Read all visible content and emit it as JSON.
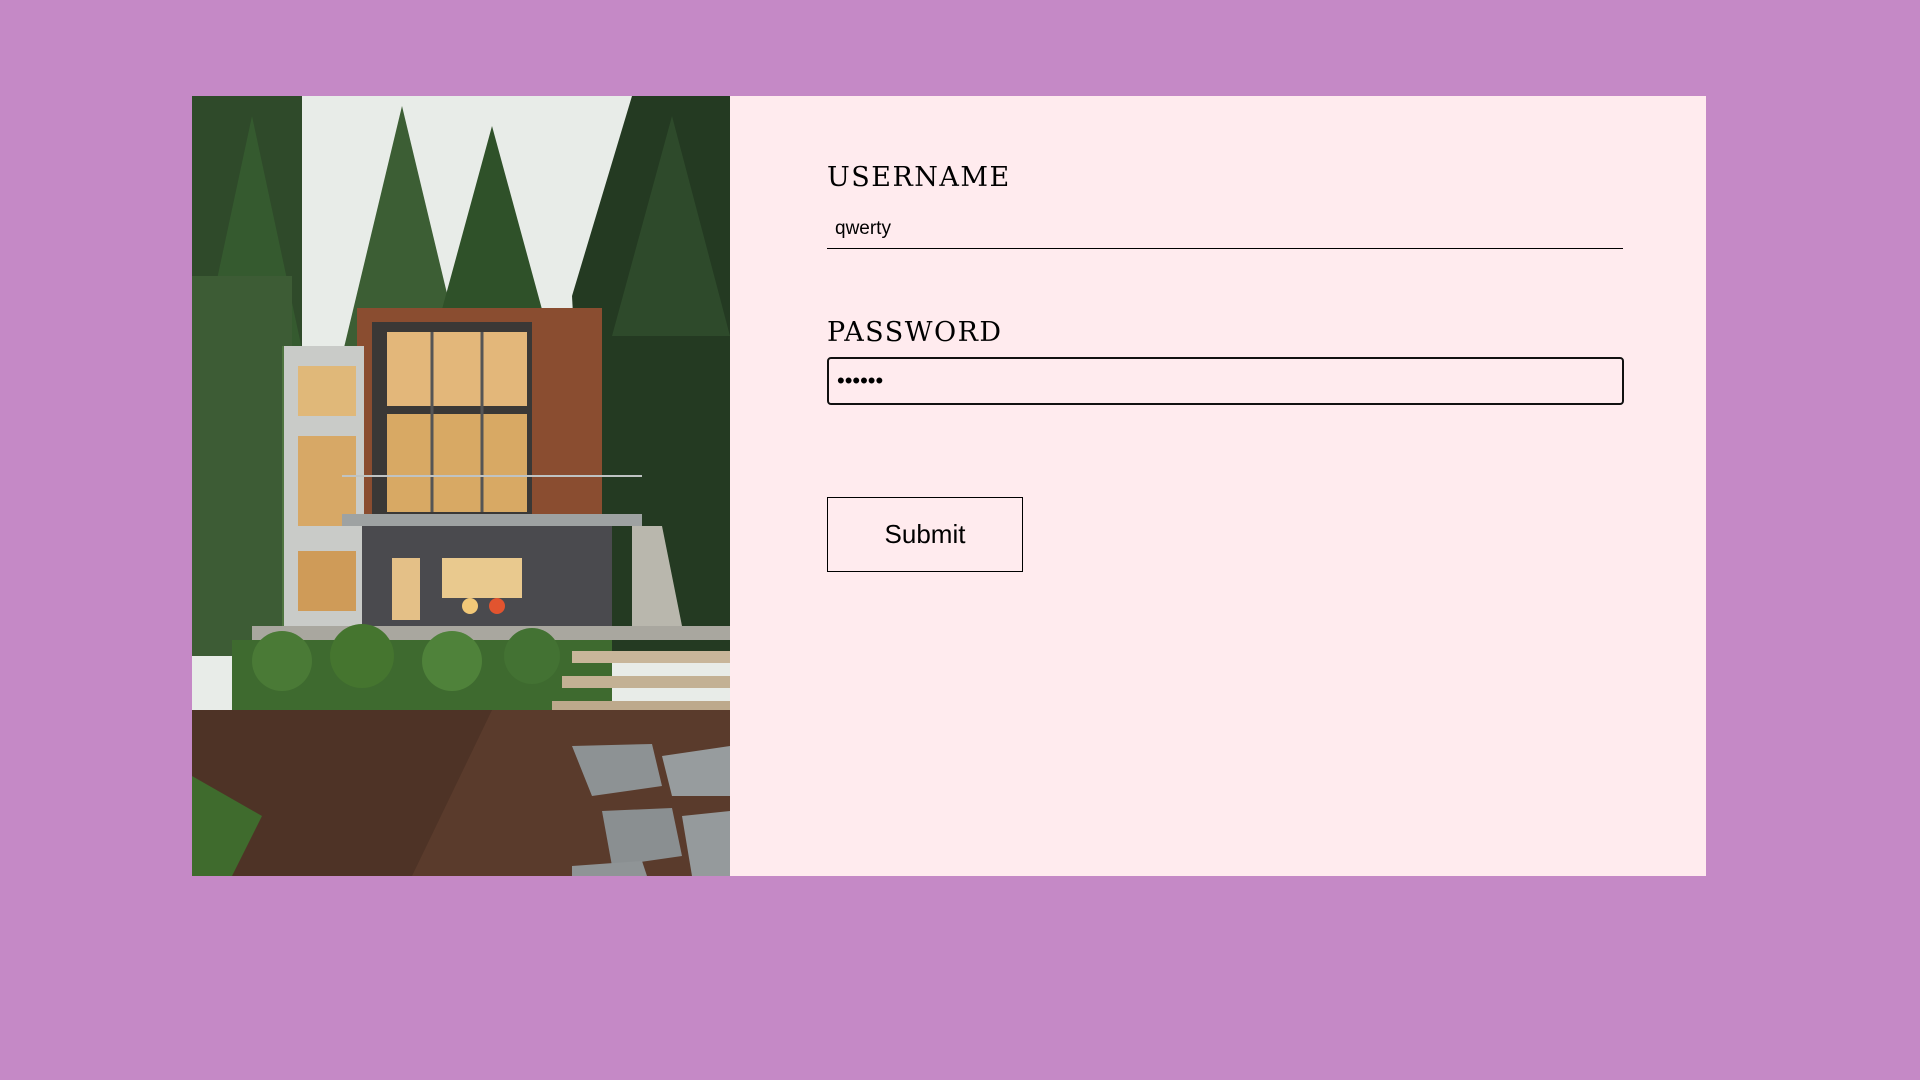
{
  "form": {
    "username_label": "USERNAME",
    "username_value": "qwerty",
    "password_label": "PASSWORD",
    "password_value": "••••••",
    "submit_label": "Submit"
  },
  "colors": {
    "page_background": "#c589c6",
    "form_background": "#ffebee"
  },
  "image": {
    "subject": "modern-house-photo"
  }
}
